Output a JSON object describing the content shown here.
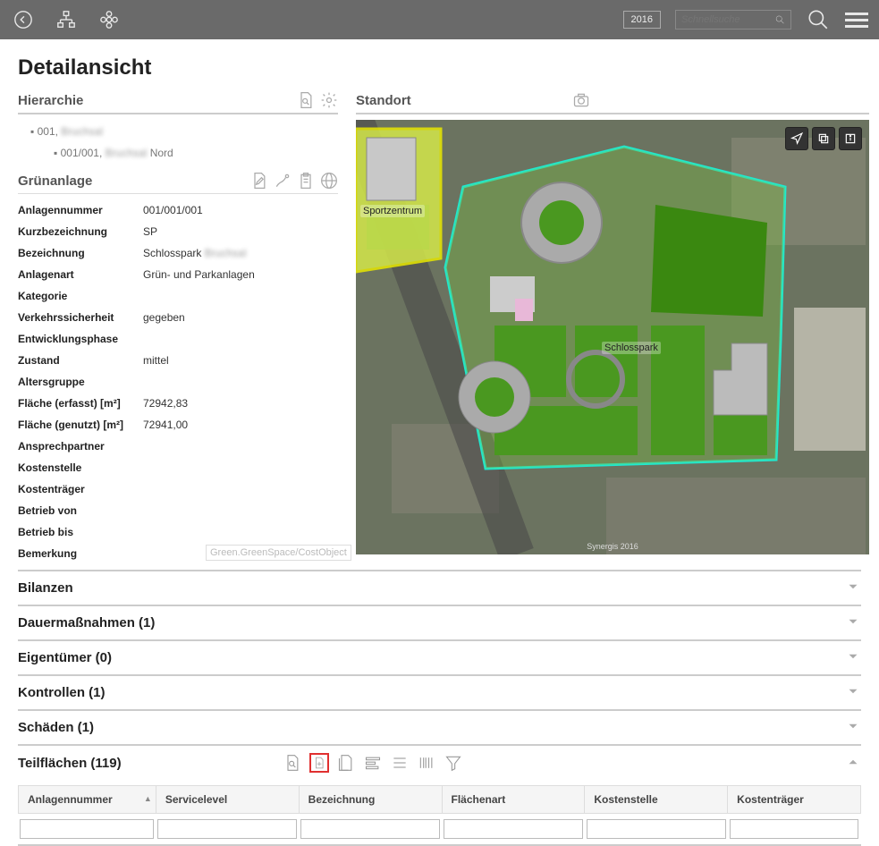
{
  "header": {
    "year": "2016",
    "search_placeholder": "Schnellsuche"
  },
  "page_title": "Detailansicht",
  "hierarchy": {
    "title": "Hierarchie",
    "items": [
      {
        "code": "001,",
        "name_blur": "Bruchsal"
      },
      {
        "code": "001/001,",
        "name_blur": "Bruchsal",
        "suffix": "Nord"
      }
    ]
  },
  "greenspace": {
    "title": "Grünanlage",
    "rows": [
      {
        "label": "Anlagennummer",
        "value": "001/001/001"
      },
      {
        "label": "Kurzbezeichnung",
        "value": "SP"
      },
      {
        "label": "Bezeichnung",
        "value": "Schlosspark",
        "blur_suffix": "Bruchsal"
      },
      {
        "label": "Anlagenart",
        "value": "Grün- und Parkanlagen"
      },
      {
        "label": "Kategorie",
        "value": ""
      },
      {
        "label": "Verkehrssicherheit",
        "value": "gegeben"
      },
      {
        "label": "Entwicklungsphase",
        "value": ""
      },
      {
        "label": "Zustand",
        "value": "mittel"
      },
      {
        "label": "Altersgruppe",
        "value": ""
      },
      {
        "label": "Fläche (erfasst) [m²]",
        "value": "72942,83"
      },
      {
        "label": "Fläche (genutzt) [m²]",
        "value": "72941,00"
      },
      {
        "label": "Ansprechpartner",
        "value": ""
      },
      {
        "label": "Kostenstelle",
        "value": ""
      },
      {
        "label": "Kostenträger",
        "value": ""
      },
      {
        "label": "Betrieb von",
        "value": ""
      },
      {
        "label": "Betrieb bis",
        "value": ""
      },
      {
        "label": "Bemerkung",
        "value": ""
      }
    ],
    "tooltip": "Green.GreenSpace/CostObject"
  },
  "standort": {
    "title": "Standort",
    "map_labels": {
      "sport": "Sportzentrum",
      "park": "Schlosspark"
    },
    "copyright": "Synergis 2016"
  },
  "accordion": [
    {
      "title": "Bilanzen",
      "expanded": false
    },
    {
      "title": "Dauermaßnahmen (1)",
      "expanded": false
    },
    {
      "title": "Eigentümer (0)",
      "expanded": false
    },
    {
      "title": "Kontrollen (1)",
      "expanded": false
    },
    {
      "title": "Schäden (1)",
      "expanded": false
    },
    {
      "title": "Teilflächen (119)",
      "expanded": true
    }
  ],
  "grid": {
    "columns": [
      "Anlagennummer",
      "Servicelevel",
      "Bezeichnung",
      "Flächenart",
      "Kostenstelle",
      "Kostenträger"
    ]
  }
}
